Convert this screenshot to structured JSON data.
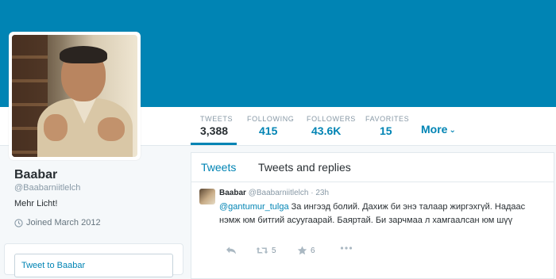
{
  "colors": {
    "banner": "#0084b4",
    "accent": "#0084b4",
    "muted": "#8899a6"
  },
  "profile": {
    "name": "Baabar",
    "handle": "@Baabarniitlelch",
    "bio": "Mehr Licht!",
    "joined": "Joined March 2012",
    "joined_icon": "clock-icon"
  },
  "nav": {
    "stats": [
      {
        "label": "TWEETS",
        "value": "3,388"
      },
      {
        "label": "FOLLOWING",
        "value": "415"
      },
      {
        "label": "FOLLOWERS",
        "value": "43.6K"
      },
      {
        "label": "FAVORITES",
        "value": "15"
      }
    ],
    "more_label": "More"
  },
  "tweetbox": {
    "label": "Tweet to Baabar"
  },
  "stream": {
    "tabs": [
      {
        "label": "Tweets"
      },
      {
        "label": "Tweets and replies"
      }
    ],
    "tweet": {
      "name": "Baabar",
      "handle": "@Baabarniitlelch",
      "separator": "·",
      "time": "23h",
      "mention": "@gantumur_tulga",
      "text": " За ингээд болий. Дахиж би энэ талаар жиргэхгүй. Надаас нэмж юм битгий асуугаарай. Баяртай. Би зарчмаа л хамгаалсан юм шүү",
      "retweets": "5",
      "favorites": "6"
    }
  }
}
